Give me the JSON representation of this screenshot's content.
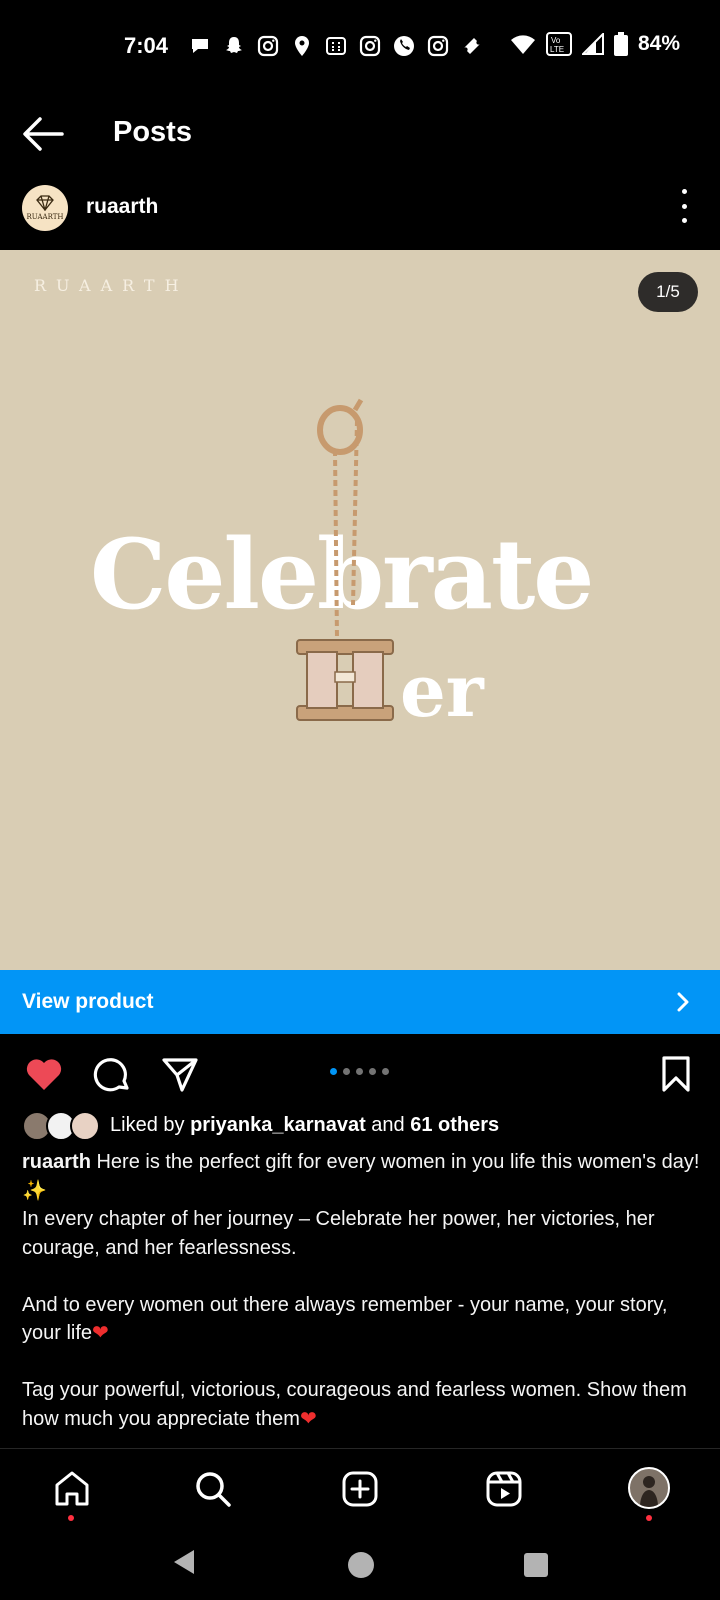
{
  "status_bar": {
    "time": "7:04",
    "battery": "84%",
    "icons": [
      "chat-bubble-icon",
      "snapchat-icon",
      "instagram-icon",
      "location-pin-icon",
      "calculator-icon",
      "instagram-icon",
      "phone-icon",
      "instagram-icon",
      "ticket-icon",
      "wifi-icon",
      "volte-icon",
      "signal-icon",
      "battery-icon"
    ],
    "volte_label": "Vo LTE"
  },
  "header": {
    "title": "Posts",
    "back_icon": "arrow-left-icon"
  },
  "post": {
    "username": "ruaarth",
    "avatar_text": "RUAARTH",
    "image": {
      "watermark": "RUAARTH",
      "counter": "1/5",
      "headline_1": "Celebrate",
      "headline_2": "er"
    },
    "view_product_label": "View product",
    "carousel": {
      "count": 5,
      "active": 0
    },
    "likes": {
      "prefix": "Liked by ",
      "user": "priyanka_karnavat",
      "middle": " and ",
      "others": "61 others"
    },
    "caption": {
      "username": "ruaarth",
      "line1": " Here is the perfect gift for every women in you life this women's day!",
      "line2": " In every chapter of her journey – Celebrate her power, her victories, her courage, and her fearlessness.",
      "line3": "And to every women out there always remember -  your name, your story, your life",
      "line4": "Tag your powerful, victorious, courageous and fearless women. Show them how much you appreciate them",
      "sparkles": "✨",
      "heart": "❤"
    }
  },
  "colors": {
    "accent_blue": "#0295f6",
    "like_red": "#ed4956",
    "image_bg": "#d9cdb4"
  }
}
